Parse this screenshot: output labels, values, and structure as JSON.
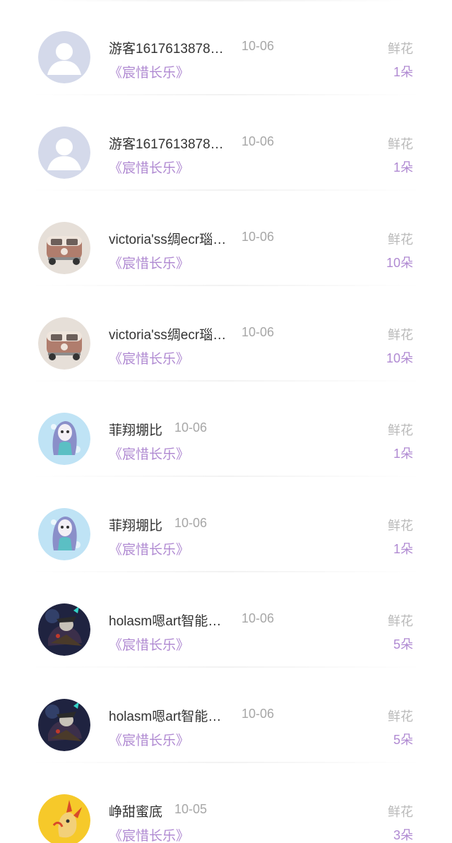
{
  "gifts": [
    {
      "name": "游客1617613878…",
      "date": "10-06",
      "book": "《宸惜长乐》",
      "gift_label": "鲜花",
      "count": "1朵",
      "avatar_icon": "default-user-avatar-icon"
    },
    {
      "name": "游客1617613878…",
      "date": "10-06",
      "book": "《宸惜长乐》",
      "gift_label": "鲜花",
      "count": "1朵",
      "avatar_icon": "default-user-avatar-icon"
    },
    {
      "name": "victoria'ss绸ecr瑙…",
      "date": "10-06",
      "book": "《宸惜长乐》",
      "gift_label": "鲜花",
      "count": "10朵",
      "avatar_icon": "vintage-van-avatar-icon"
    },
    {
      "name": "victoria'ss绸ecr瑙…",
      "date": "10-06",
      "book": "《宸惜长乐》",
      "gift_label": "鲜花",
      "count": "10朵",
      "avatar_icon": "vintage-van-avatar-icon"
    },
    {
      "name": "菲翔堋比",
      "date": "10-06",
      "book": "《宸惜长乐》",
      "gift_label": "鲜花",
      "count": "1朵",
      "avatar_icon": "anime-girl-avatar-icon"
    },
    {
      "name": "菲翔堋比",
      "date": "10-06",
      "book": "《宸惜长乐》",
      "gift_label": "鲜花",
      "count": "1朵",
      "avatar_icon": "anime-girl-avatar-icon"
    },
    {
      "name": "holasm嗯art智能…",
      "date": "10-06",
      "book": "《宸惜长乐》",
      "gift_label": "鲜花",
      "count": "5朵",
      "avatar_icon": "game-character-avatar-icon"
    },
    {
      "name": "holasm嗯art智能…",
      "date": "10-06",
      "book": "《宸惜长乐》",
      "gift_label": "鲜花",
      "count": "5朵",
      "avatar_icon": "game-character-avatar-icon"
    },
    {
      "name": "峥甜蜜底",
      "date": "10-05",
      "book": "《宸惜长乐》",
      "gift_label": "鲜花",
      "count": "3朵",
      "avatar_icon": "cartoon-pokemon-avatar-icon"
    }
  ],
  "colors": {
    "book_and_count": "#b08ad2",
    "name": "#333333",
    "date": "#a7a7a7",
    "label": "#b9b9b9"
  }
}
